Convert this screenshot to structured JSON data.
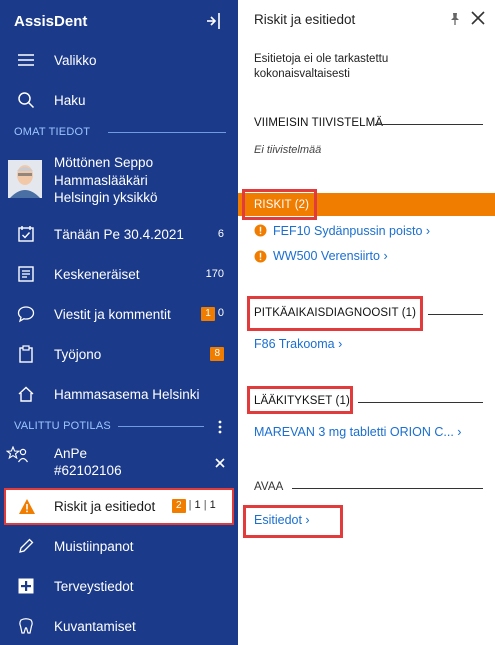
{
  "sidebar": {
    "brand": "AssisDent",
    "menu": "Valikko",
    "search": "Haku",
    "own_section": "OMAT TIEDOT",
    "user": {
      "name": "Möttönen Seppo",
      "role": "Hammaslääkäri",
      "unit": "Helsingin yksikkö"
    },
    "today": {
      "label": "Tänään Pe 30.4.2021",
      "count": "6"
    },
    "unfinished": {
      "label": "Keskeneräiset",
      "count": "170"
    },
    "messages": {
      "label": "Viestit ja kommentit",
      "badge": "1",
      "count": "0"
    },
    "queue": {
      "label": "Työjono",
      "badge": "8"
    },
    "clinic": "Hammasasema Helsinki",
    "patient_section": "VALITTU POTILAS",
    "patient": {
      "name": "AnPe",
      "id": "#62102106"
    },
    "risks": {
      "label": "Riskit ja esitiedot",
      "badge": "2",
      "c1": "1",
      "c2": "1"
    },
    "notes": "Muistiinpanot",
    "health": "Terveystiedot",
    "imaging": "Kuvantamiset"
  },
  "panel": {
    "title": "Riskit ja esitiedot",
    "subtitle": "Esitietoja ei ole tarkastettu kokonaisvaltaisesti",
    "summary_heading": "VIIMEISIN TIIVISTELMÄ",
    "summary_empty": "Ei tiivistelmää",
    "risks_heading": "RISKIT (2)",
    "risk_items": [
      "FEF10 Sydänpussin poisto",
      "WW500 Verensiirto"
    ],
    "diag_heading": "PITKÄAIKAISDIAGNOOSIT (1)",
    "diag_items": [
      "F86 Trakooma"
    ],
    "med_heading": "LÄÄKITYKSET (1)",
    "med_items": [
      "MAREVAN 3 mg tabletti ORION C..."
    ],
    "open_heading": "AVAA",
    "open_link": "Esitiedot"
  },
  "colors": {
    "sidebar": "#1b3a8a",
    "accent": "#f07d00",
    "link": "#1a6fd0",
    "highlight": "#e23b3b"
  }
}
